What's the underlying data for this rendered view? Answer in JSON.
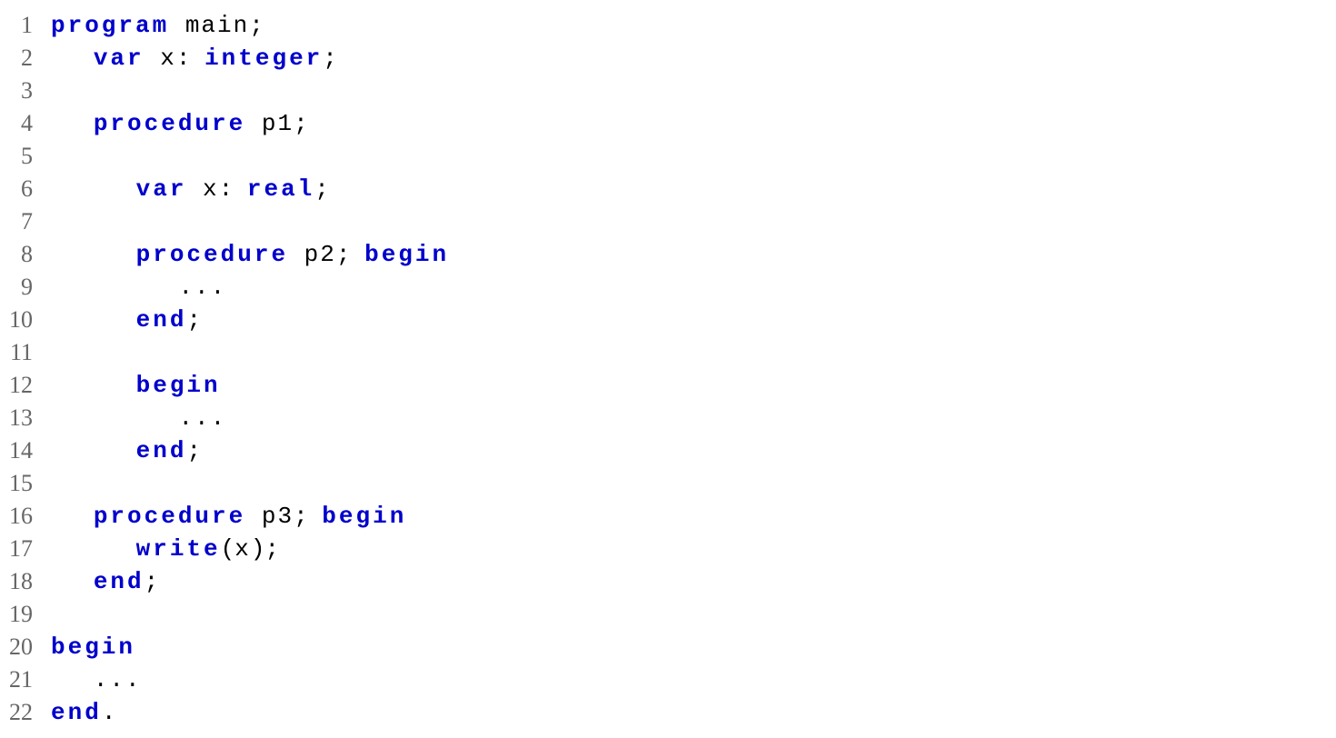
{
  "lineNumbers": [
    "1",
    "2",
    "3",
    "4",
    "5",
    "6",
    "7",
    "8",
    "9",
    "10",
    "11",
    "12",
    "13",
    "14",
    "15",
    "16",
    "17",
    "18",
    "19",
    "20",
    "21",
    "22"
  ],
  "code": {
    "l1_kw1": "program",
    "l1_id": " main",
    "l1_p": ";",
    "l2_kw1": "var",
    "l2_id1": " x",
    "l2_p1": ": ",
    "l2_kw2": "integer",
    "l2_p2": ";",
    "l4_kw1": "procedure",
    "l4_id": " p1",
    "l4_p": ";",
    "l6_kw1": "var",
    "l6_id": " x",
    "l6_p1": ": ",
    "l6_kw2": "real",
    "l6_p2": ";",
    "l8_kw1": "procedure",
    "l8_id": " p2",
    "l8_p1": "; ",
    "l8_kw2": "begin",
    "l9_dots": "...",
    "l10_kw": "end",
    "l10_p": ";",
    "l12_kw": "begin",
    "l13_dots": "...",
    "l14_kw": "end",
    "l14_p": ";",
    "l16_kw1": "procedure",
    "l16_id": " p3",
    "l16_p1": "; ",
    "l16_kw2": "begin",
    "l17_kw": "write",
    "l17_p1": "(",
    "l17_id": "x",
    "l17_p2": ");",
    "l18_kw": "end",
    "l18_p": ";",
    "l20_kw": "begin",
    "l21_dots": "...",
    "l22_kw": "end",
    "l22_p": "."
  }
}
